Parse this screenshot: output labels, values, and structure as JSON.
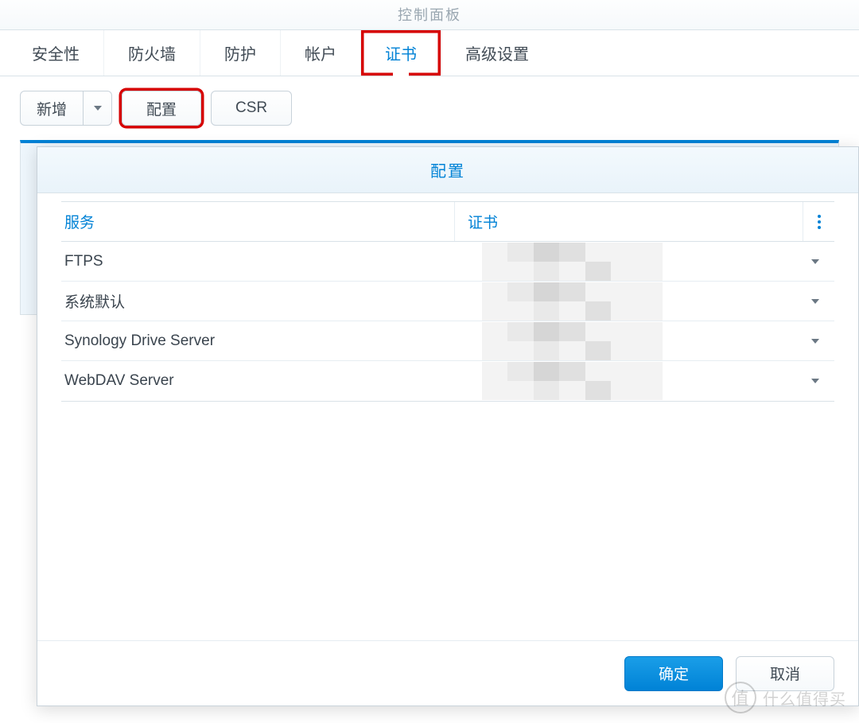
{
  "window": {
    "title": "控制面板"
  },
  "tabs": [
    {
      "label": "安全性"
    },
    {
      "label": "防火墙"
    },
    {
      "label": "防护"
    },
    {
      "label": "帐户"
    },
    {
      "label": "证书"
    },
    {
      "label": "高级设置"
    }
  ],
  "toolbar": {
    "add": "新增",
    "configure": "配置",
    "csr": "CSR"
  },
  "dialog": {
    "title": "配置",
    "col_service": "服务",
    "col_cert": "证书",
    "rows": [
      {
        "service": "FTPS"
      },
      {
        "service": "系统默认"
      },
      {
        "service": "Synology Drive Server"
      },
      {
        "service": "WebDAV Server"
      }
    ],
    "ok": "确定",
    "cancel": "取消"
  },
  "watermark": {
    "badge": "值",
    "text": "什么值得买"
  }
}
